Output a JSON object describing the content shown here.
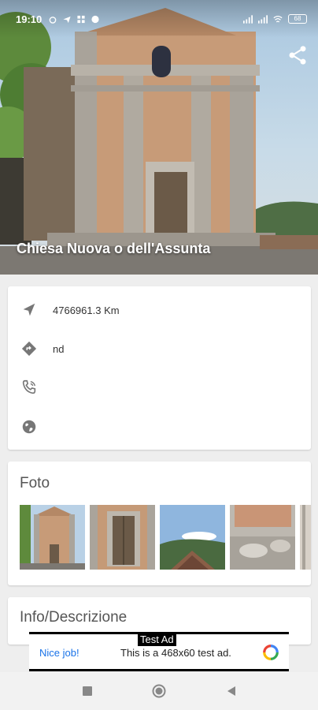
{
  "status_bar": {
    "time": "19:10",
    "battery": "68"
  },
  "hero": {
    "title": "Chiesa Nuova o dell'Assunta"
  },
  "info": {
    "distance": "4766961.3 Km",
    "directions": "nd",
    "phone": "",
    "website": ""
  },
  "photos": {
    "title": "Foto",
    "items": [
      "church-facade",
      "church-door",
      "rooftop-landscape",
      "ruins-stone"
    ]
  },
  "description": {
    "title": "Info/Descrizione"
  },
  "ad": {
    "label": "Test Ad",
    "nice": "Nice job!",
    "message": "This is a 468x60 test ad."
  },
  "colors": {
    "link": "#1a73e8",
    "icon": "#777777"
  }
}
